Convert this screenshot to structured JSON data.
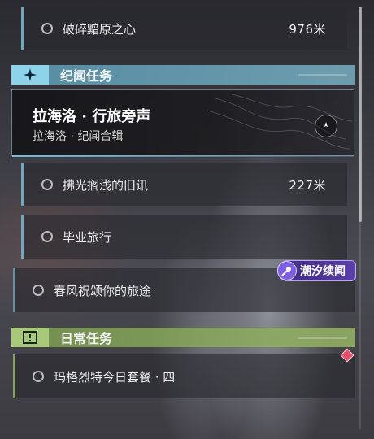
{
  "quests": {
    "q1": {
      "name": "破碎黯原之心",
      "distance": "976米"
    },
    "q2": {
      "name": "拂光搁浅的旧讯",
      "distance": "227米"
    },
    "q3": {
      "name": "毕业旅行"
    },
    "q4": {
      "name": "春风祝颂你的旅途"
    },
    "q5": {
      "name": "玛格烈特今日套餐 · 四"
    }
  },
  "sections": {
    "chronicle": {
      "title": "纪闻任务",
      "color": "#8fd3ea"
    },
    "daily": {
      "title": "日常任务",
      "color": "#a8c87a"
    }
  },
  "main_card": {
    "title": "拉海洛 · 行旅旁声",
    "subtitle": "拉海洛 · 纪闻合辑"
  },
  "event_tag": {
    "label": "潮汐续闻",
    "color": "#5a3fa8"
  },
  "icons": {
    "chronicle_badge": "sparkle-icon",
    "daily_badge": "exclamation-icon",
    "card_icon": "compass-icon",
    "event_icon": "comet-icon",
    "marker": "diamond-icon"
  }
}
